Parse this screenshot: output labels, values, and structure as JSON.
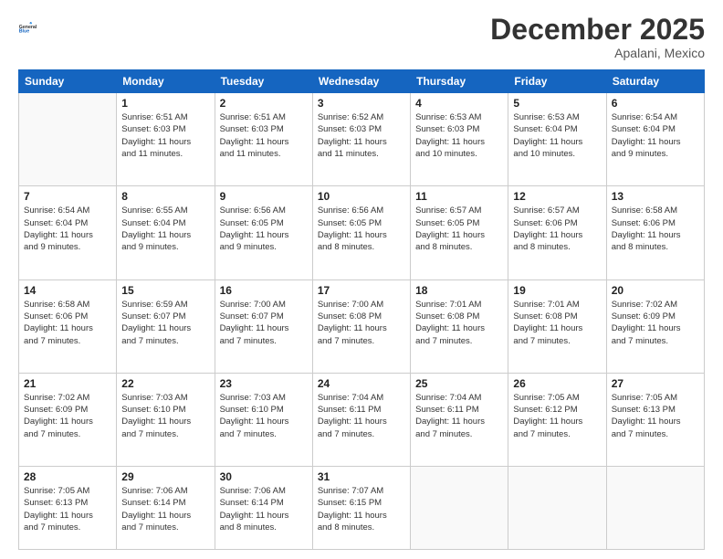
{
  "header": {
    "logo_general": "General",
    "logo_blue": "Blue",
    "month_title": "December 2025",
    "location": "Apalani, Mexico"
  },
  "days_of_week": [
    "Sunday",
    "Monday",
    "Tuesday",
    "Wednesday",
    "Thursday",
    "Friday",
    "Saturday"
  ],
  "weeks": [
    [
      {
        "day": "",
        "info": ""
      },
      {
        "day": "1",
        "info": "Sunrise: 6:51 AM\nSunset: 6:03 PM\nDaylight: 11 hours\nand 11 minutes."
      },
      {
        "day": "2",
        "info": "Sunrise: 6:51 AM\nSunset: 6:03 PM\nDaylight: 11 hours\nand 11 minutes."
      },
      {
        "day": "3",
        "info": "Sunrise: 6:52 AM\nSunset: 6:03 PM\nDaylight: 11 hours\nand 11 minutes."
      },
      {
        "day": "4",
        "info": "Sunrise: 6:53 AM\nSunset: 6:03 PM\nDaylight: 11 hours\nand 10 minutes."
      },
      {
        "day": "5",
        "info": "Sunrise: 6:53 AM\nSunset: 6:04 PM\nDaylight: 11 hours\nand 10 minutes."
      },
      {
        "day": "6",
        "info": "Sunrise: 6:54 AM\nSunset: 6:04 PM\nDaylight: 11 hours\nand 9 minutes."
      }
    ],
    [
      {
        "day": "7",
        "info": "Sunrise: 6:54 AM\nSunset: 6:04 PM\nDaylight: 11 hours\nand 9 minutes."
      },
      {
        "day": "8",
        "info": "Sunrise: 6:55 AM\nSunset: 6:04 PM\nDaylight: 11 hours\nand 9 minutes."
      },
      {
        "day": "9",
        "info": "Sunrise: 6:56 AM\nSunset: 6:05 PM\nDaylight: 11 hours\nand 9 minutes."
      },
      {
        "day": "10",
        "info": "Sunrise: 6:56 AM\nSunset: 6:05 PM\nDaylight: 11 hours\nand 8 minutes."
      },
      {
        "day": "11",
        "info": "Sunrise: 6:57 AM\nSunset: 6:05 PM\nDaylight: 11 hours\nand 8 minutes."
      },
      {
        "day": "12",
        "info": "Sunrise: 6:57 AM\nSunset: 6:06 PM\nDaylight: 11 hours\nand 8 minutes."
      },
      {
        "day": "13",
        "info": "Sunrise: 6:58 AM\nSunset: 6:06 PM\nDaylight: 11 hours\nand 8 minutes."
      }
    ],
    [
      {
        "day": "14",
        "info": "Sunrise: 6:58 AM\nSunset: 6:06 PM\nDaylight: 11 hours\nand 7 minutes."
      },
      {
        "day": "15",
        "info": "Sunrise: 6:59 AM\nSunset: 6:07 PM\nDaylight: 11 hours\nand 7 minutes."
      },
      {
        "day": "16",
        "info": "Sunrise: 7:00 AM\nSunset: 6:07 PM\nDaylight: 11 hours\nand 7 minutes."
      },
      {
        "day": "17",
        "info": "Sunrise: 7:00 AM\nSunset: 6:08 PM\nDaylight: 11 hours\nand 7 minutes."
      },
      {
        "day": "18",
        "info": "Sunrise: 7:01 AM\nSunset: 6:08 PM\nDaylight: 11 hours\nand 7 minutes."
      },
      {
        "day": "19",
        "info": "Sunrise: 7:01 AM\nSunset: 6:08 PM\nDaylight: 11 hours\nand 7 minutes."
      },
      {
        "day": "20",
        "info": "Sunrise: 7:02 AM\nSunset: 6:09 PM\nDaylight: 11 hours\nand 7 minutes."
      }
    ],
    [
      {
        "day": "21",
        "info": "Sunrise: 7:02 AM\nSunset: 6:09 PM\nDaylight: 11 hours\nand 7 minutes."
      },
      {
        "day": "22",
        "info": "Sunrise: 7:03 AM\nSunset: 6:10 PM\nDaylight: 11 hours\nand 7 minutes."
      },
      {
        "day": "23",
        "info": "Sunrise: 7:03 AM\nSunset: 6:10 PM\nDaylight: 11 hours\nand 7 minutes."
      },
      {
        "day": "24",
        "info": "Sunrise: 7:04 AM\nSunset: 6:11 PM\nDaylight: 11 hours\nand 7 minutes."
      },
      {
        "day": "25",
        "info": "Sunrise: 7:04 AM\nSunset: 6:11 PM\nDaylight: 11 hours\nand 7 minutes."
      },
      {
        "day": "26",
        "info": "Sunrise: 7:05 AM\nSunset: 6:12 PM\nDaylight: 11 hours\nand 7 minutes."
      },
      {
        "day": "27",
        "info": "Sunrise: 7:05 AM\nSunset: 6:13 PM\nDaylight: 11 hours\nand 7 minutes."
      }
    ],
    [
      {
        "day": "28",
        "info": "Sunrise: 7:05 AM\nSunset: 6:13 PM\nDaylight: 11 hours\nand 7 minutes."
      },
      {
        "day": "29",
        "info": "Sunrise: 7:06 AM\nSunset: 6:14 PM\nDaylight: 11 hours\nand 7 minutes."
      },
      {
        "day": "30",
        "info": "Sunrise: 7:06 AM\nSunset: 6:14 PM\nDaylight: 11 hours\nand 8 minutes."
      },
      {
        "day": "31",
        "info": "Sunrise: 7:07 AM\nSunset: 6:15 PM\nDaylight: 11 hours\nand 8 minutes."
      },
      {
        "day": "",
        "info": ""
      },
      {
        "day": "",
        "info": ""
      },
      {
        "day": "",
        "info": ""
      }
    ]
  ]
}
